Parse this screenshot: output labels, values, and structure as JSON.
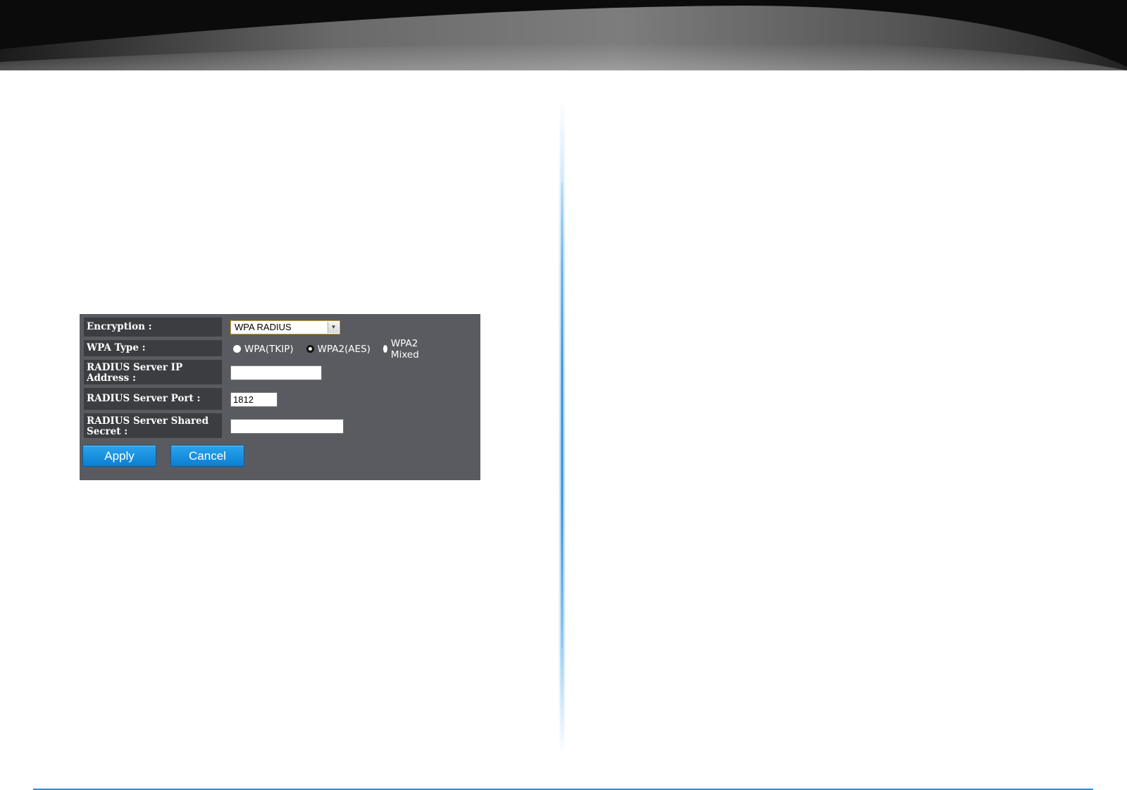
{
  "form": {
    "encryption": {
      "label": "Encryption :",
      "value": "WPA RADIUS",
      "arrow": "▾"
    },
    "wpa_type": {
      "label": "WPA Type :",
      "options": [
        {
          "label": "WPA(TKIP)",
          "selected": false
        },
        {
          "label": "WPA2(AES)",
          "selected": true
        },
        {
          "label": "WPA2 Mixed",
          "selected": false
        }
      ]
    },
    "radius_ip": {
      "label": "RADIUS Server IP Address :",
      "value": ""
    },
    "radius_port": {
      "label": "RADIUS Server Port :",
      "value": "1812"
    },
    "radius_secret": {
      "label": "RADIUS Server Shared Secret :",
      "value": ""
    },
    "apply_label": "Apply",
    "cancel_label": "Cancel"
  },
  "colors": {
    "panel_bg": "#595b60",
    "label_bg": "#3b3d41",
    "button_blue": "#1a8fdf",
    "accent_line": "#2b8fd6"
  }
}
